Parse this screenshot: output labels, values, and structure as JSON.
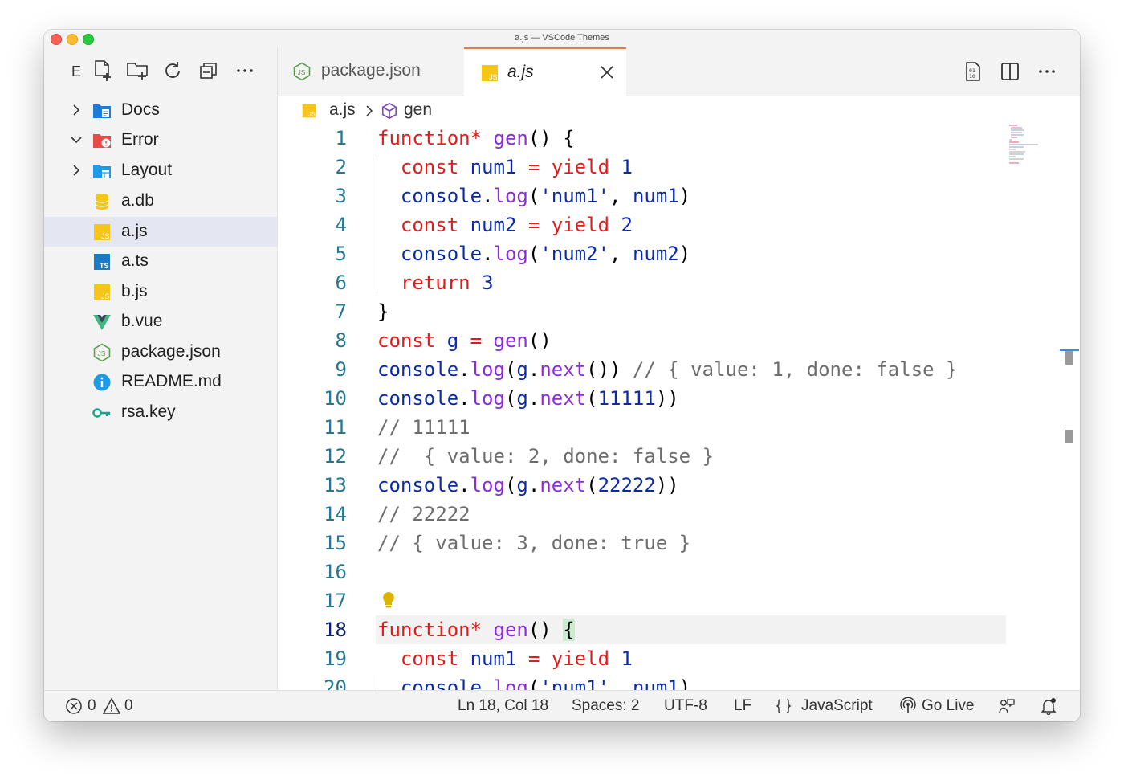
{
  "window": {
    "title": "a.js — VSCode Themes"
  },
  "explorer": {
    "toolbar_letter": "E",
    "items": [
      {
        "label": "Docs",
        "type": "folder",
        "expanded": false,
        "icon": "folder-docs-icon"
      },
      {
        "label": "Error",
        "type": "folder",
        "expanded": true,
        "icon": "folder-error-icon"
      },
      {
        "label": "Layout",
        "type": "folder",
        "expanded": false,
        "icon": "folder-layout-icon"
      },
      {
        "label": "a.db",
        "type": "file",
        "icon": "database-icon"
      },
      {
        "label": "a.js",
        "type": "file",
        "icon": "javascript-icon",
        "selected": true
      },
      {
        "label": "a.ts",
        "type": "file",
        "icon": "typescript-icon"
      },
      {
        "label": "b.js",
        "type": "file",
        "icon": "javascript-icon"
      },
      {
        "label": "b.vue",
        "type": "file",
        "icon": "vue-icon"
      },
      {
        "label": "package.json",
        "type": "file",
        "icon": "nodejs-icon"
      },
      {
        "label": "README.md",
        "type": "file",
        "icon": "info-icon"
      },
      {
        "label": "rsa.key",
        "type": "file",
        "icon": "key-icon"
      }
    ]
  },
  "tabs": [
    {
      "label": "package.json",
      "icon": "nodejs-icon",
      "active": false
    },
    {
      "label": "a.js",
      "icon": "javascript-icon",
      "active": true
    }
  ],
  "breadcrumb": {
    "file": "a.js",
    "symbol": "gen"
  },
  "editor": {
    "current_line": 18,
    "lines": [
      {
        "n": "1"
      },
      {
        "n": "2"
      },
      {
        "n": "3"
      },
      {
        "n": "4"
      },
      {
        "n": "5"
      },
      {
        "n": "6"
      },
      {
        "n": "7"
      },
      {
        "n": "8"
      },
      {
        "n": "9"
      },
      {
        "n": "10"
      },
      {
        "n": "11"
      },
      {
        "n": "12"
      },
      {
        "n": "13"
      },
      {
        "n": "14"
      },
      {
        "n": "15"
      },
      {
        "n": "16"
      },
      {
        "n": "17"
      },
      {
        "n": "18"
      },
      {
        "n": "19"
      },
      {
        "n": "20"
      }
    ]
  },
  "statusbar": {
    "errors": "0",
    "warnings": "0",
    "position": "Ln 18, Col 18",
    "spaces": "Spaces: 2",
    "encoding": "UTF-8",
    "eol": "LF",
    "language": "JavaScript",
    "golive": "Go Live"
  },
  "colors": {
    "keyword": "#e51a1a",
    "function": "#8a2be2",
    "variable": "#0a2aa8",
    "comment": "#6d6d6d",
    "line_number": "#237893",
    "active_tab_border": "#e8794a"
  }
}
